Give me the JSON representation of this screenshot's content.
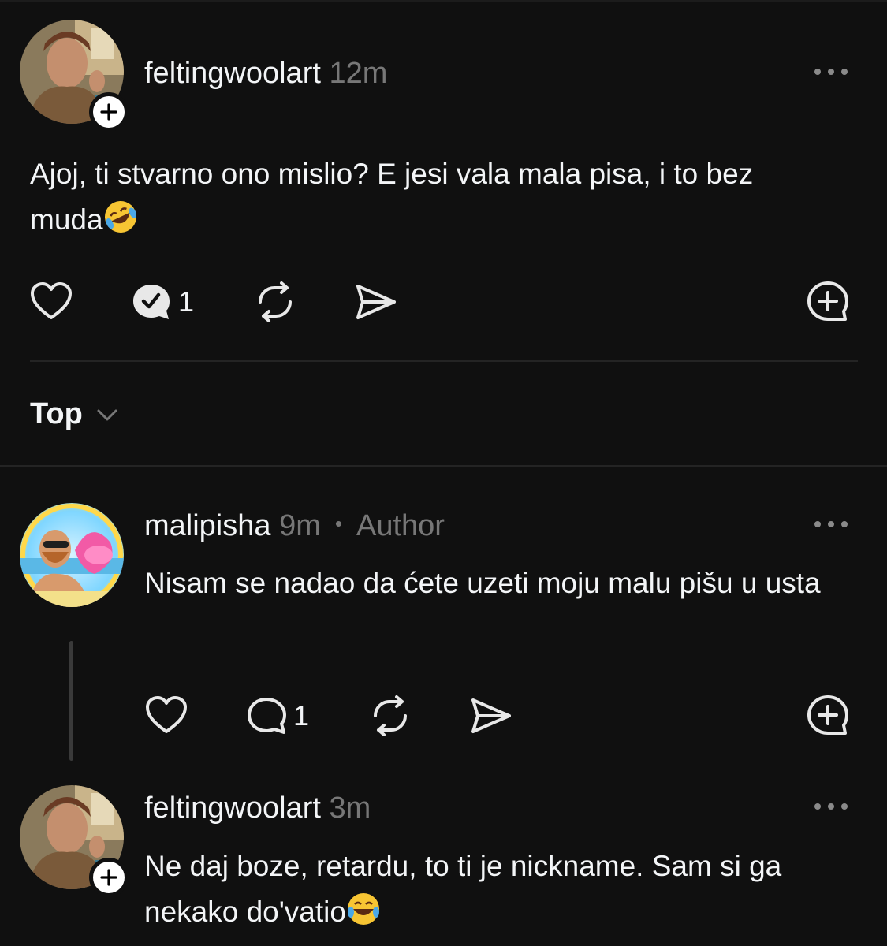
{
  "posts": [
    {
      "username": "feltingwoolart",
      "time": "12m",
      "text": "Ajoj, ti stvarno ono mislio? E jesi vala mala pisa, i to bez muda",
      "emoji": "rolling-on-floor-laughing",
      "reply_count": "1"
    },
    {
      "username": "malipisha",
      "time": "9m",
      "tag": "Author",
      "text": "Nisam se nadao da ćete uzeti moju malu pišu u usta",
      "reply_count": "1"
    },
    {
      "username": "feltingwoolart",
      "time": "3m",
      "text": "Ne daj boze, retardu, to ti je nickname. Sam si ga nekako do'vatio",
      "emoji": "face-with-tears-of-joy"
    }
  ],
  "sort": {
    "label": "Top"
  },
  "colors": {
    "background": "#101010",
    "text": "#f3f5f7",
    "muted": "#777777",
    "divider": "#242424"
  }
}
